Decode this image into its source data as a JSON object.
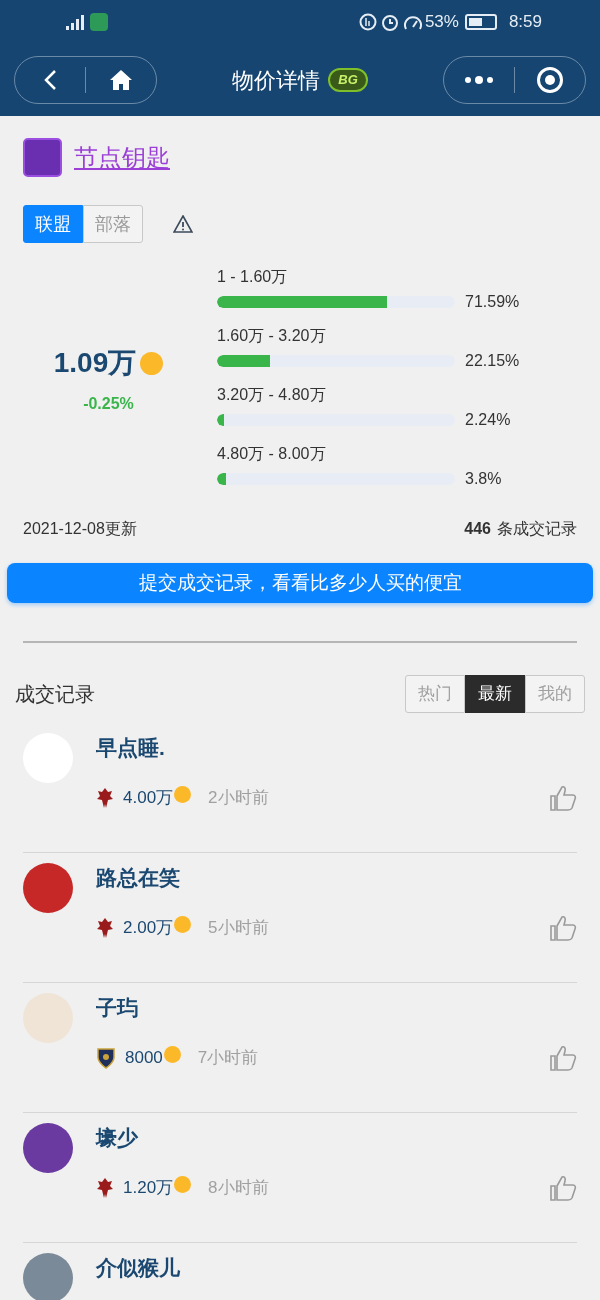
{
  "status_bar": {
    "battery": "53%",
    "time": "8:59"
  },
  "nav": {
    "title": "物价详情",
    "logo_text": "BG"
  },
  "item": {
    "name": "节点钥匙"
  },
  "faction_tabs": [
    {
      "label": "联盟",
      "selected": true
    },
    {
      "label": "部落",
      "selected": false
    }
  ],
  "price": {
    "value": "1.09万",
    "change": "-0.25%"
  },
  "distribution": [
    {
      "range": "1 - 1.60万",
      "level": 0.7159,
      "percent": "71.59%"
    },
    {
      "range": "1.60万 - 3.20万",
      "level": 0.2215,
      "percent": "22.15%"
    },
    {
      "range": "3.20万 - 4.80万",
      "level": 0.0224,
      "percent": "2.24%"
    },
    {
      "range": "4.80万 - 8.00万",
      "level": 0.038,
      "percent": "3.8%"
    }
  ],
  "updated": "2021-12-08更新",
  "record_count": "446",
  "record_count_label": "条成交记录",
  "submit_button": "提交成交记录，看看比多少人买的便宜",
  "records_title": "成交记录",
  "record_tabs": [
    {
      "label": "热门",
      "selected": false
    },
    {
      "label": "最新",
      "selected": true
    },
    {
      "label": "我的",
      "selected": false
    }
  ],
  "records": [
    {
      "name": "早点睡.",
      "kind": "horde",
      "price": "4.00万",
      "time": "2小时前"
    },
    {
      "name": "路总在笑",
      "kind": "horde",
      "price": "2.00万",
      "time": "5小时前"
    },
    {
      "name": "子玙",
      "kind": "alliance",
      "price": "8000",
      "time": "7小时前"
    },
    {
      "name": "壕少",
      "kind": "horde",
      "price": "1.20万",
      "time": "8小时前"
    },
    {
      "name": "介似猴儿"
    }
  ]
}
